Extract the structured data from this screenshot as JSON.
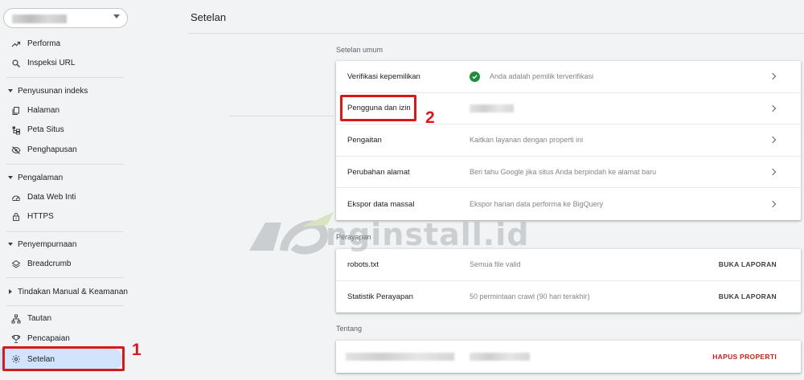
{
  "page": {
    "title": "Setelan"
  },
  "sidebar": {
    "items": [
      {
        "label": "Performa",
        "icon": "trending-up-icon"
      },
      {
        "label": "Inspeksi URL",
        "icon": "search-icon"
      }
    ],
    "sections": [
      {
        "label": "Penyusunan indeks",
        "items": [
          {
            "label": "Halaman",
            "icon": "pages-icon"
          },
          {
            "label": "Peta Situs",
            "icon": "sitemap-icon"
          },
          {
            "label": "Penghapusan",
            "icon": "removal-icon"
          }
        ]
      },
      {
        "label": "Pengalaman",
        "items": [
          {
            "label": "Data Web Inti",
            "icon": "gauge-icon"
          },
          {
            "label": "HTTPS",
            "icon": "lock-icon"
          }
        ]
      },
      {
        "label": "Penyempurnaan",
        "items": [
          {
            "label": "Breadcrumb",
            "icon": "layers-icon"
          }
        ]
      },
      {
        "label": "Tindakan Manual & Keamanan"
      }
    ],
    "bottom_items": [
      {
        "label": "Tautan",
        "icon": "links-icon"
      },
      {
        "label": "Pencapaian",
        "icon": "trophy-icon"
      },
      {
        "label": "Setelan",
        "icon": "gear-icon",
        "active": true
      }
    ]
  },
  "general": {
    "title": "Setelan umum",
    "rows": [
      {
        "label": "Verifikasi kepemilikan",
        "value": "Anda adalah pemilik terverifikasi"
      },
      {
        "label": "Pengguna dan izin",
        "value": ""
      },
      {
        "label": "Pengaitan",
        "value": "Kaitkan layanan dengan properti ini"
      },
      {
        "label": "Perubahan alamat",
        "value": "Beri tahu Google jika situs Anda berpindah ke alamat baru"
      },
      {
        "label": "Ekspor data massal",
        "value": "Ekspor harian data performa ke BigQuery"
      }
    ]
  },
  "crawl": {
    "title": "Perayapan",
    "rows": [
      {
        "label": "robots.txt",
        "value": "Semua file valid",
        "action": "BUKA LAPORAN"
      },
      {
        "label": "Statistik Perayapan",
        "value": "50 permintaan crawl (90 hari terakhir)",
        "action": "BUKA LAPORAN"
      }
    ]
  },
  "about": {
    "title": "Tentang",
    "action": "HAPUS PROPERTI"
  },
  "annotations": {
    "step1": "1",
    "step2": "2"
  },
  "watermark": {
    "text": "nginstall.id"
  },
  "colors": {
    "accent": "#1a73e8",
    "active_bg": "#d2e3fc",
    "highlight": "#d7191c",
    "success": "#1e8e3e",
    "danger": "#c5221f"
  }
}
